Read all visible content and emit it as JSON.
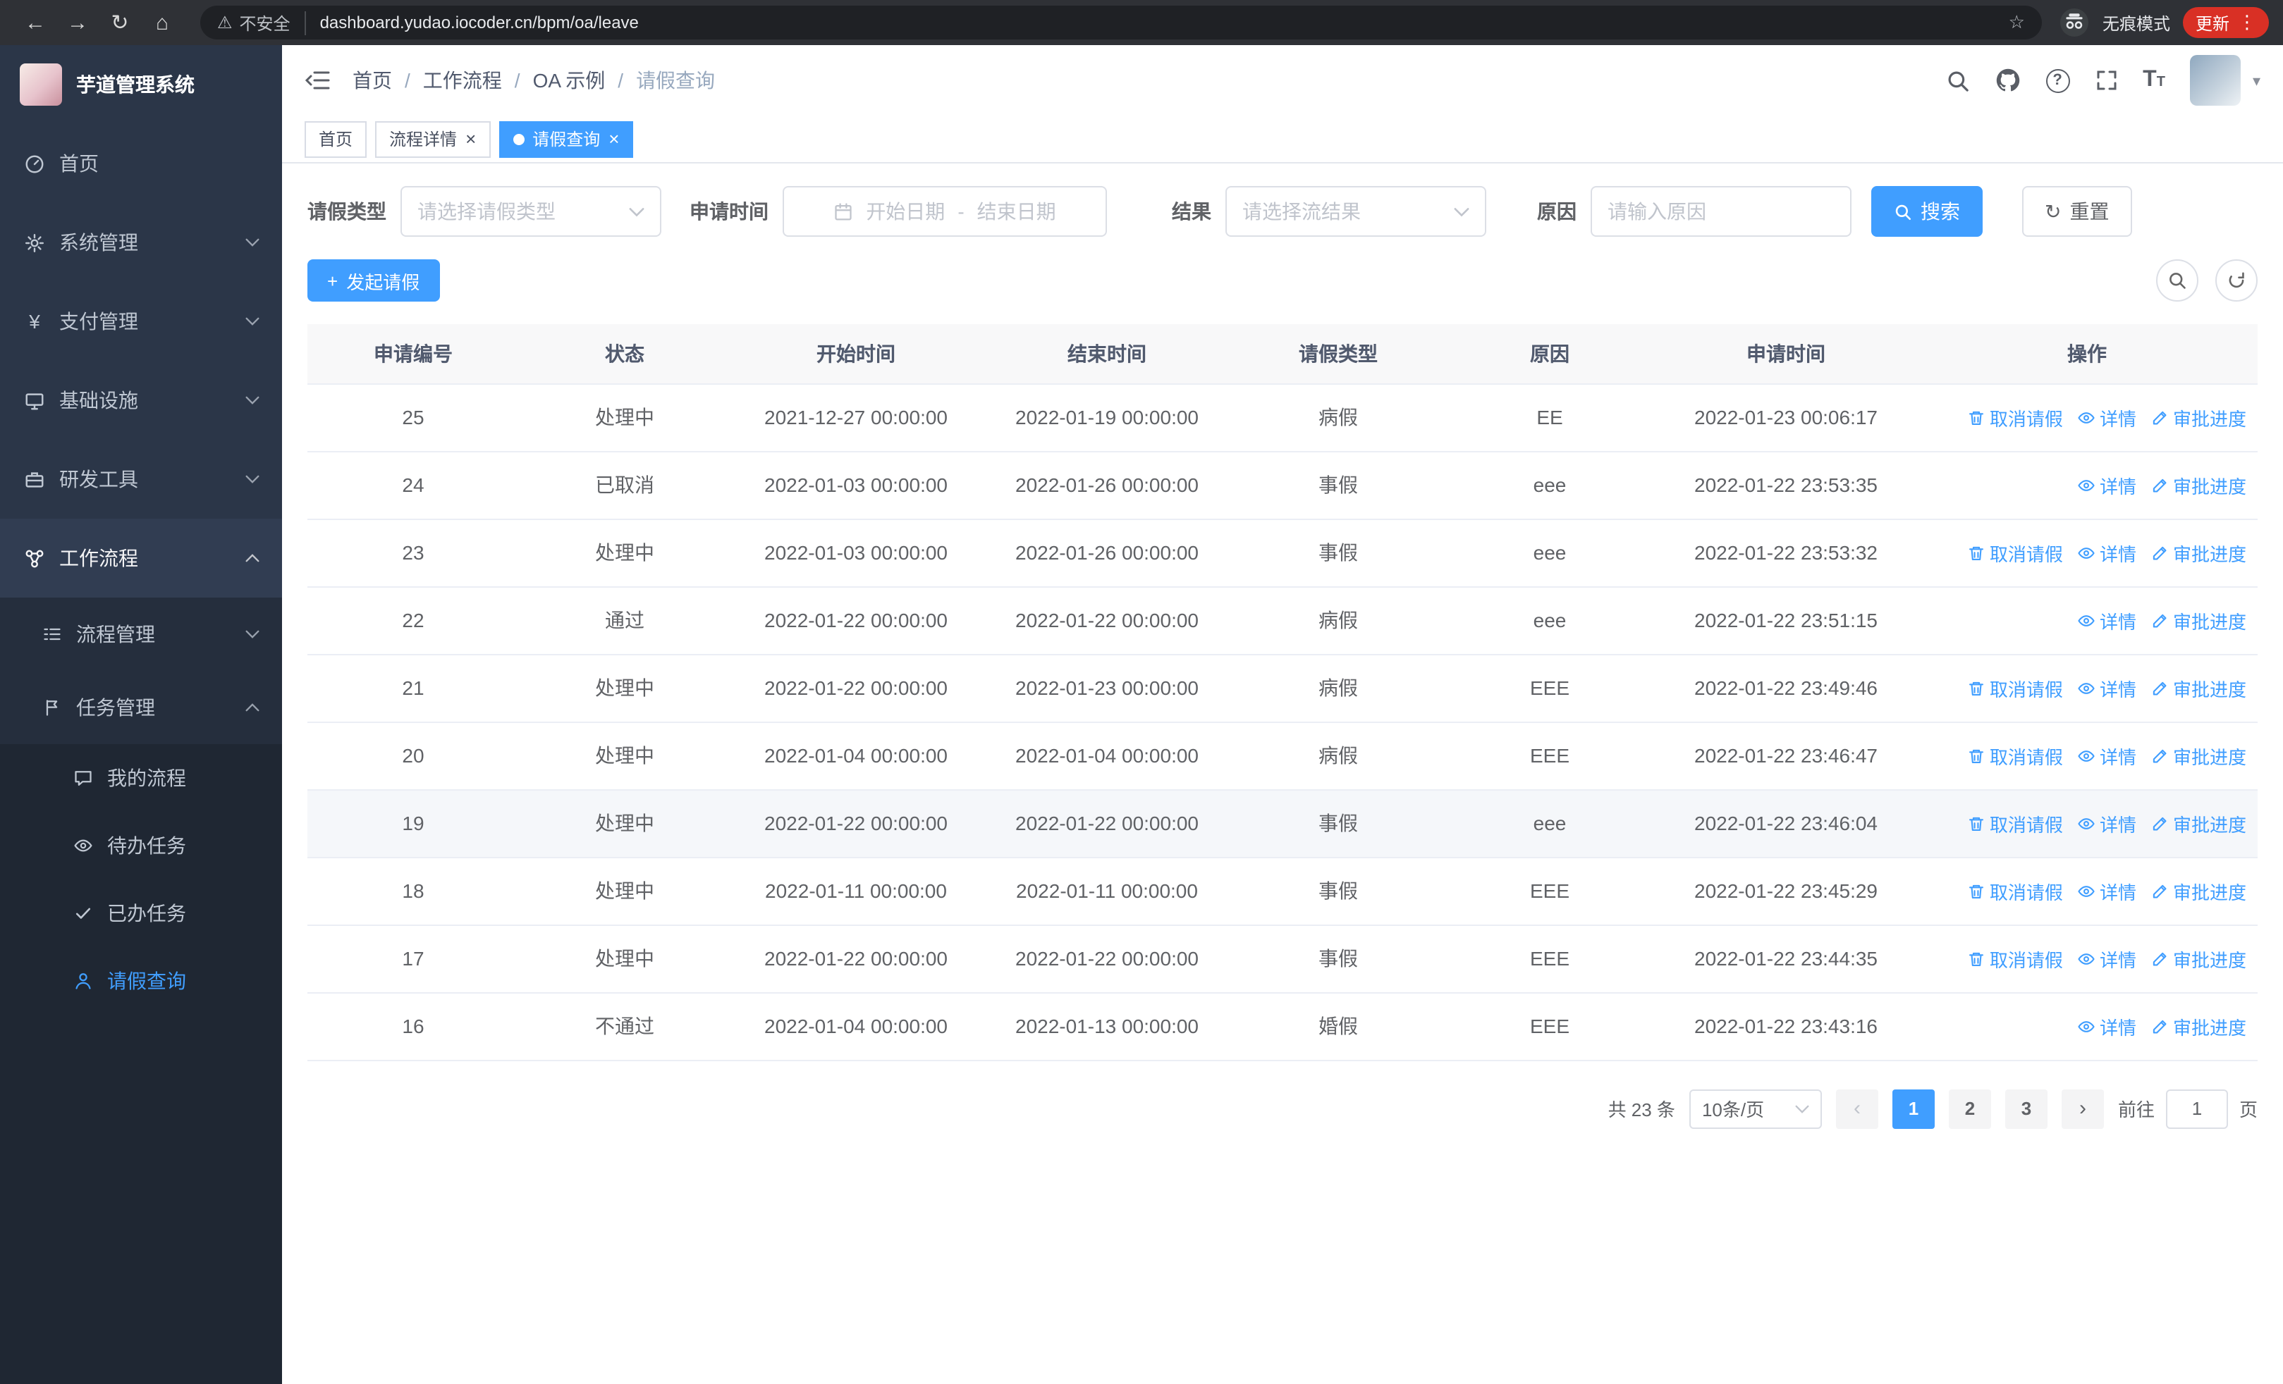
{
  "browser": {
    "security_warning": "不安全",
    "url": "dashboard.yudao.iocoder.cn/bpm/oa/leave",
    "incognito_label": "无痕模式",
    "update_label": "更新"
  },
  "icons": {
    "back": "←",
    "forward": "→",
    "reload": "↻",
    "home": "⌂",
    "warning": "⚠",
    "star": "☆",
    "menu_dots": "⋮",
    "caret_down": "▾",
    "tab_close": "×",
    "plus": "+",
    "payment": "¥",
    "prev": "‹",
    "next": "›",
    "breadcrumb_separator": "/",
    "help": "?",
    "font_size_large": "T",
    "font_size_small": "T"
  },
  "sidebar": {
    "app_title": "芋道管理系统",
    "items": [
      {
        "label": "首页",
        "icon": "dashboard-icon",
        "level": 1
      },
      {
        "label": "系统管理",
        "icon": "gear-icon",
        "level": 1,
        "expandable": true
      },
      {
        "label": "支付管理",
        "icon": "payment-icon",
        "level": 1,
        "expandable": true
      },
      {
        "label": "基础设施",
        "icon": "infrastructure-icon",
        "level": 1,
        "expandable": true
      },
      {
        "label": "研发工具",
        "icon": "devtools-icon",
        "level": 1,
        "expandable": true
      },
      {
        "label": "工作流程",
        "icon": "workflow-icon",
        "level": 1,
        "expandable": true,
        "expanded": true
      },
      {
        "label": "流程管理",
        "icon": "process-icon",
        "level": 2,
        "expandable": true
      },
      {
        "label": "任务管理",
        "icon": "task-icon",
        "level": 2,
        "expandable": true,
        "expanded": true
      },
      {
        "label": "我的流程",
        "icon": "chat-icon",
        "level": 3
      },
      {
        "label": "待办任务",
        "icon": "eye-icon",
        "level": 3
      },
      {
        "label": "已办任务",
        "icon": "check-icon",
        "level": 3
      },
      {
        "label": "请假查询",
        "icon": "user-icon",
        "level": 3,
        "active": true
      }
    ]
  },
  "header": {
    "breadcrumb": [
      "首页",
      "工作流程",
      "OA 示例",
      "请假查询"
    ]
  },
  "tabs": [
    {
      "label": "首页",
      "closable": false,
      "active": false
    },
    {
      "label": "流程详情",
      "closable": true,
      "active": false
    },
    {
      "label": "请假查询",
      "closable": true,
      "active": true
    }
  ],
  "filters": {
    "leave_type_label": "请假类型",
    "leave_type_placeholder": "请选择请假类型",
    "apply_time_label": "申请时间",
    "start_date_placeholder": "开始日期",
    "range_separator": "-",
    "end_date_placeholder": "结束日期",
    "result_label": "结果",
    "result_placeholder": "请选择流结果",
    "reason_label": "原因",
    "reason_placeholder": "请输入原因",
    "search_button": "搜索",
    "reset_button": "重置"
  },
  "toolbar": {
    "create_button": "发起请假"
  },
  "table": {
    "columns": [
      "申请编号",
      "状态",
      "开始时间",
      "结束时间",
      "请假类型",
      "原因",
      "申请时间",
      "操作"
    ],
    "action_labels": {
      "cancel": "取消请假",
      "detail": "详情",
      "progress": "审批进度"
    },
    "rows": [
      {
        "id": "25",
        "status": "处理中",
        "start": "2021-12-27 00:00:00",
        "end": "2022-01-19 00:00:00",
        "type": "病假",
        "reason": "EE",
        "apply_time": "2022-01-23 00:06:17",
        "actions": [
          "cancel",
          "detail",
          "progress"
        ]
      },
      {
        "id": "24",
        "status": "已取消",
        "start": "2022-01-03 00:00:00",
        "end": "2022-01-26 00:00:00",
        "type": "事假",
        "reason": "eee",
        "apply_time": "2022-01-22 23:53:35",
        "actions": [
          "detail",
          "progress"
        ]
      },
      {
        "id": "23",
        "status": "处理中",
        "start": "2022-01-03 00:00:00",
        "end": "2022-01-26 00:00:00",
        "type": "事假",
        "reason": "eee",
        "apply_time": "2022-01-22 23:53:32",
        "actions": [
          "cancel",
          "detail",
          "progress"
        ]
      },
      {
        "id": "22",
        "status": "通过",
        "start": "2022-01-22 00:00:00",
        "end": "2022-01-22 00:00:00",
        "type": "病假",
        "reason": "eee",
        "apply_time": "2022-01-22 23:51:15",
        "actions": [
          "detail",
          "progress"
        ]
      },
      {
        "id": "21",
        "status": "处理中",
        "start": "2022-01-22 00:00:00",
        "end": "2022-01-23 00:00:00",
        "type": "病假",
        "reason": "EEE",
        "apply_time": "2022-01-22 23:49:46",
        "actions": [
          "cancel",
          "detail",
          "progress"
        ]
      },
      {
        "id": "20",
        "status": "处理中",
        "start": "2022-01-04 00:00:00",
        "end": "2022-01-04 00:00:00",
        "type": "病假",
        "reason": "EEE",
        "apply_time": "2022-01-22 23:46:47",
        "actions": [
          "cancel",
          "detail",
          "progress"
        ]
      },
      {
        "id": "19",
        "status": "处理中",
        "start": "2022-01-22 00:00:00",
        "end": "2022-01-22 00:00:00",
        "type": "事假",
        "reason": "eee",
        "apply_time": "2022-01-22 23:46:04",
        "actions": [
          "cancel",
          "detail",
          "progress"
        ],
        "highlight": true
      },
      {
        "id": "18",
        "status": "处理中",
        "start": "2022-01-11 00:00:00",
        "end": "2022-01-11 00:00:00",
        "type": "事假",
        "reason": "EEE",
        "apply_time": "2022-01-22 23:45:29",
        "actions": [
          "cancel",
          "detail",
          "progress"
        ]
      },
      {
        "id": "17",
        "status": "处理中",
        "start": "2022-01-22 00:00:00",
        "end": "2022-01-22 00:00:00",
        "type": "事假",
        "reason": "EEE",
        "apply_time": "2022-01-22 23:44:35",
        "actions": [
          "cancel",
          "detail",
          "progress"
        ]
      },
      {
        "id": "16",
        "status": "不通过",
        "start": "2022-01-04 00:00:00",
        "end": "2022-01-13 00:00:00",
        "type": "婚假",
        "reason": "EEE",
        "apply_time": "2022-01-22 23:43:16",
        "actions": [
          "detail",
          "progress"
        ]
      }
    ]
  },
  "pagination": {
    "total": "共 23 条",
    "page_size": "10条/页",
    "pages": [
      "1",
      "2",
      "3"
    ],
    "active_page": "1",
    "goto_prefix": "前往",
    "goto_value": "1",
    "goto_suffix": "页"
  }
}
